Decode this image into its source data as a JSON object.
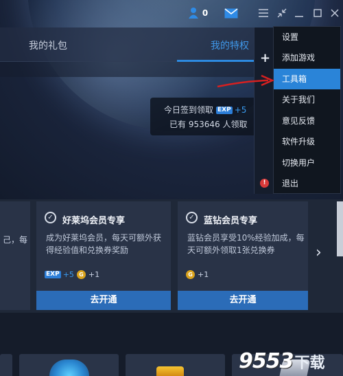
{
  "titlebar": {
    "user_count": "0",
    "icons": [
      "user-icon",
      "mail-icon",
      "menu-icon",
      "shrink-icon",
      "minimize-icon",
      "maximize-icon",
      "close-icon"
    ]
  },
  "tabs": [
    {
      "label": "我的礼包",
      "active": false
    },
    {
      "label": "我的特权",
      "active": true
    }
  ],
  "signin": {
    "line1_prefix": "今日签到领取",
    "exp_label": "EXP",
    "exp_plus": "+5",
    "line2": "已有 953646 人领取"
  },
  "sidebar": {
    "plus_label": "+",
    "alert_label": "!"
  },
  "menu": {
    "items": [
      {
        "label": "设置",
        "active": false
      },
      {
        "label": "添加游戏",
        "active": false
      },
      {
        "label": "工具箱",
        "active": true
      },
      {
        "label": "关于我们",
        "active": false
      },
      {
        "label": "意见反馈",
        "active": false
      },
      {
        "label": "软件升级",
        "active": false
      },
      {
        "label": "切换用户",
        "active": false
      },
      {
        "label": "退出",
        "active": false
      }
    ]
  },
  "cards": {
    "left_partial_text": "己，每",
    "hollywood": {
      "title": "好莱坞会员专享",
      "desc": "成为好莱坞会员，每天可额外获得经验值和兑换券奖励",
      "exp_label": "EXP",
      "exp_plus": "+5",
      "coin_label": "G",
      "coin_plus": "+1",
      "button": "去开通"
    },
    "bluediamond": {
      "title": "蓝钻会员专享",
      "desc": "蓝钻会员享受10%经验加成，每天可额外领取1张兑换券",
      "coin_label": "G",
      "coin_plus": "+1",
      "button": "去开通"
    },
    "next_label": "›"
  },
  "watermark": {
    "num": "9553",
    "cn": "下载"
  },
  "colors": {
    "accent": "#2a84d8",
    "button": "#2b6cb8",
    "annotation": "#d62020"
  }
}
